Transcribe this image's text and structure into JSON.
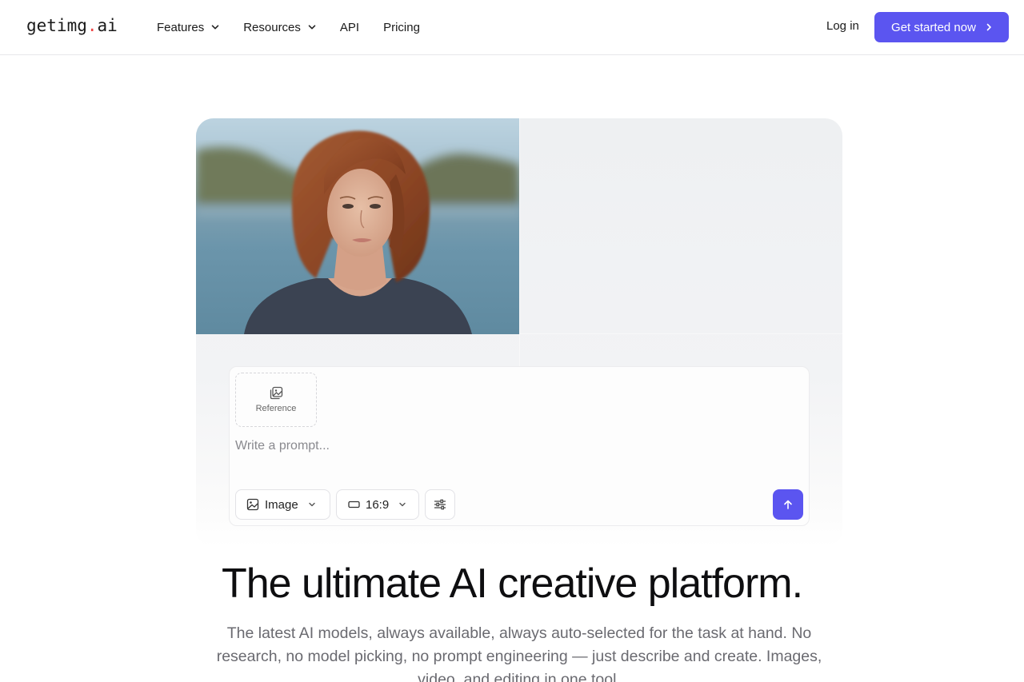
{
  "header": {
    "logo_main": "getimg",
    "logo_dot": ".",
    "logo_tld": "ai",
    "nav": [
      {
        "label": "Features",
        "has_dropdown": true
      },
      {
        "label": "Resources",
        "has_dropdown": true
      },
      {
        "label": "API",
        "has_dropdown": false
      },
      {
        "label": "Pricing",
        "has_dropdown": false
      }
    ],
    "login_label": "Log in",
    "cta_label": "Get started now"
  },
  "composer": {
    "reference_label": "Reference",
    "prompt_placeholder": "Write a prompt...",
    "prompt_value": "",
    "mode_label": "Image",
    "ratio_label": "16:9"
  },
  "hero": {
    "title": "The ultimate AI creative platform.",
    "subtitle": "The latest AI models, always available, always auto-selected for the task at hand. No research, no model picking, no prompt engineering — just describe and create. Images, video, and editing in one tool."
  },
  "colors": {
    "accent": "#5b55f0",
    "logo_dot": "#ef4444"
  },
  "icons": [
    "chevron-down-icon",
    "chevron-right-icon",
    "reference-image-icon",
    "image-icon",
    "aspect-ratio-icon",
    "settings-sliders-icon",
    "arrow-up-icon"
  ]
}
